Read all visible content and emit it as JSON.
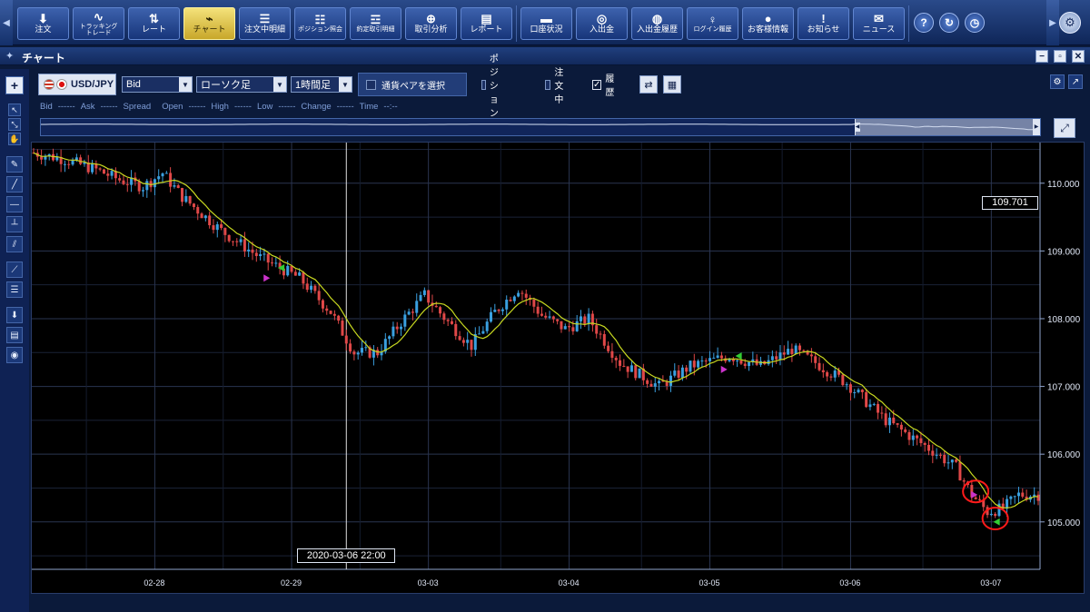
{
  "toolbar": {
    "buttons": [
      {
        "label": "注文",
        "icon": "arrow-down-icon"
      },
      {
        "label": "トラッキング\nトレード",
        "icon": "tracking-icon"
      },
      {
        "label": "レート",
        "icon": "rate-icon"
      },
      {
        "label": "チャート",
        "icon": "chart-icon",
        "active": true
      },
      {
        "label": "注文中明細",
        "icon": "order-list-icon"
      },
      {
        "label": "ポジション照会",
        "icon": "position-icon"
      },
      {
        "label": "約定取引明細",
        "icon": "execution-icon"
      },
      {
        "label": "取引分析",
        "icon": "analysis-icon"
      },
      {
        "label": "レポート",
        "icon": "report-icon"
      },
      {
        "label": "口座状況",
        "icon": "account-icon"
      },
      {
        "label": "入出金",
        "icon": "deposit-icon"
      },
      {
        "label": "入出金履歴",
        "icon": "deposit-history-icon"
      },
      {
        "label": "ログイン履歴",
        "icon": "login-history-icon"
      },
      {
        "label": "お客様情報",
        "icon": "customer-icon"
      },
      {
        "label": "お知らせ",
        "icon": "notice-icon"
      },
      {
        "label": "ニュース",
        "icon": "news-icon"
      }
    ],
    "round_buttons": [
      {
        "label": "?",
        "icon": "help-icon"
      },
      {
        "label": "↻",
        "icon": "refresh-icon"
      },
      {
        "label": "◷",
        "icon": "clock-icon"
      }
    ],
    "settings_icon": "⚙"
  },
  "panel": {
    "title": "チャート",
    "minimize": "−",
    "restore": "▫",
    "close": "✕"
  },
  "controls": {
    "pair": "USD/JPY",
    "price_type": "Bid",
    "chart_type": "ローソク足",
    "timeframe": "1時間足",
    "pair_select_label": "通貨ペアを選択",
    "filters": [
      {
        "label": "ポジション",
        "checked": false
      },
      {
        "label": "注文中",
        "checked": false
      },
      {
        "label": "履歴",
        "checked": true
      }
    ]
  },
  "info_row": {
    "items": [
      {
        "label": "Bid",
        "value": "------"
      },
      {
        "label": "Ask",
        "value": "------"
      },
      {
        "label": "Spread",
        "value": ""
      },
      {
        "label": "Open",
        "value": "------"
      },
      {
        "label": "High",
        "value": "------"
      },
      {
        "label": "Low",
        "value": "------"
      },
      {
        "label": "Change",
        "value": "------"
      },
      {
        "label": "Time",
        "value": "--:--"
      }
    ]
  },
  "current_price": "109.701",
  "crosshair_time": "2020-03-06 22:00",
  "colors": {
    "up": "#3aa0e0",
    "down": "#e04848",
    "ma": "#c8d820",
    "grid": "#2a3550",
    "buy_marker": "#cc33cc",
    "sell_marker": "#33cc33",
    "highlight": "#ff1a1a"
  },
  "chart_data": {
    "type": "candlestick",
    "symbol": "USD/JPY",
    "timeframe": "1時間足",
    "ylim": [
      104.3,
      110.6
    ],
    "yticks": [
      "110.000",
      "109.000",
      "108.000",
      "107.000",
      "106.000",
      "105.000"
    ],
    "xticks": [
      "02-28",
      "02-29",
      "03-03",
      "03-04",
      "03-05",
      "03-06",
      "03-07"
    ],
    "path": [
      [
        0,
        110.45
      ],
      [
        8,
        110.35
      ],
      [
        16,
        110.2
      ],
      [
        22,
        110.05
      ],
      [
        28,
        109.95
      ],
      [
        33,
        110.15
      ],
      [
        38,
        109.8
      ],
      [
        48,
        109.3
      ],
      [
        58,
        108.9
      ],
      [
        68,
        108.6
      ],
      [
        76,
        108.1
      ],
      [
        82,
        107.5
      ],
      [
        88,
        107.5
      ],
      [
        94,
        107.95
      ],
      [
        100,
        108.35
      ],
      [
        106,
        107.95
      ],
      [
        112,
        107.6
      ],
      [
        118,
        108.1
      ],
      [
        124,
        108.45
      ],
      [
        130,
        108.05
      ],
      [
        136,
        107.85
      ],
      [
        142,
        108.0
      ],
      [
        150,
        107.35
      ],
      [
        160,
        107.0
      ],
      [
        168,
        107.3
      ],
      [
        178,
        107.45
      ],
      [
        186,
        107.3
      ],
      [
        194,
        107.55
      ],
      [
        200,
        107.35
      ],
      [
        208,
        107.05
      ],
      [
        218,
        106.5
      ],
      [
        230,
        106.05
      ],
      [
        236,
        105.8
      ],
      [
        240,
        105.4
      ],
      [
        244,
        105.15
      ],
      [
        248,
        105.2
      ],
      [
        252,
        105.4
      ]
    ],
    "trade_markers": [
      {
        "type": "buy",
        "time_index": 60,
        "price": 108.6
      },
      {
        "type": "sell",
        "time_index": 63,
        "price": 108.75
      },
      {
        "type": "buy",
        "time_index": 177,
        "price": 107.25
      },
      {
        "type": "sell",
        "time_index": 180,
        "price": 107.45
      },
      {
        "type": "buy",
        "time_index": 241,
        "price": 105.4
      },
      {
        "type": "sell",
        "time_index": 246,
        "price": 105.0
      }
    ],
    "highlight_circles": [
      {
        "time_index": 241,
        "price": 105.45
      },
      {
        "time_index": 246,
        "price": 105.05
      }
    ],
    "crosshair_time_index": 80
  }
}
